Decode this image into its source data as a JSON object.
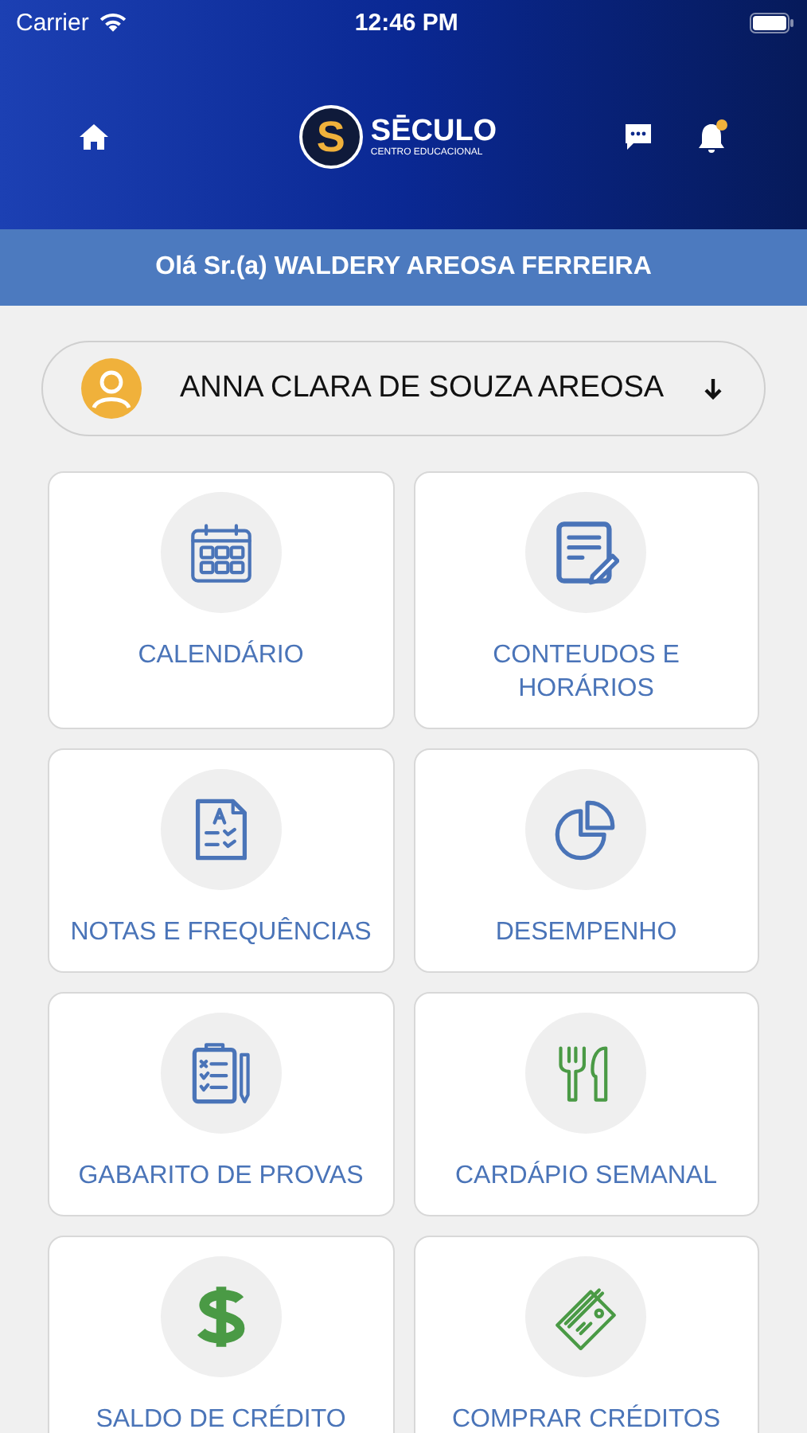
{
  "status_bar": {
    "carrier": "Carrier",
    "time": "12:46 PM"
  },
  "header": {
    "logo": {
      "mark": "S",
      "name": "SĒCULO",
      "tagline": "CENTRO EDUCACIONAL"
    },
    "notifications_unread": true
  },
  "greeting": "Olá Sr.(a) WALDERY AREOSA FERREIRA",
  "student_selector": {
    "value": "ANNA CLARA DE SOUZA AREOSA"
  },
  "menu": [
    {
      "label": "CALENDÁRIO",
      "kind": "calendar",
      "color": "#4a74b8"
    },
    {
      "label": "CONTEUDOS E HORÁRIOS",
      "kind": "document",
      "color": "#4a74b8"
    },
    {
      "label": "NOTAS E FREQUÊNCIAS",
      "kind": "grades",
      "color": "#4a74b8"
    },
    {
      "label": "DESEMPENHO",
      "kind": "pie",
      "color": "#4a74b8"
    },
    {
      "label": "GABARITO DE PROVAS",
      "kind": "clipboard",
      "color": "#4a74b8"
    },
    {
      "label": "CARDÁPIO SEMANAL",
      "kind": "cutlery",
      "color": "#4a9a45"
    },
    {
      "label": "SALDO DE CRÉDITO",
      "kind": "dollar",
      "color": "#4a9a45"
    },
    {
      "label": "COMPRAR CRÉDITOS",
      "kind": "card",
      "color": "#4a9a45"
    }
  ]
}
